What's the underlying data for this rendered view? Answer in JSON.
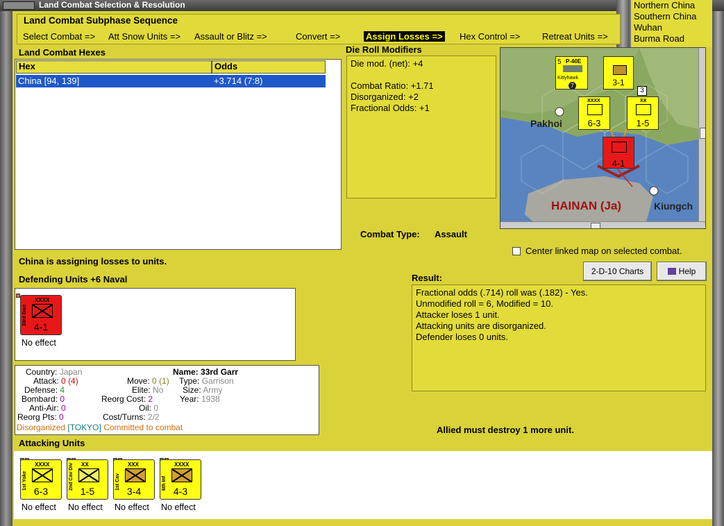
{
  "window": {
    "title": "Land Combat Selection & Resolution"
  },
  "subphase": {
    "heading": "Land Combat Subphase Sequence",
    "phases": [
      "Select Combat =>",
      "Att Snow Units =>",
      "Assault or Blitz =>",
      "Convert =>",
      "Assign Losses =>",
      "Hex Control =>",
      "Retreat Units =>"
    ],
    "active_index": 4
  },
  "hexes": {
    "heading": "Land Combat Hexes",
    "columns": [
      "Hex",
      "Odds"
    ],
    "rows": [
      {
        "hex": "China [94, 139]",
        "odds": "+3.714 (7:8)"
      }
    ]
  },
  "modifiers": {
    "heading": "Die Roll Modifiers",
    "lines": [
      "Die mod. (net): +4",
      "",
      "Combat Ratio: +1.71",
      "Disorganized: +2",
      "Fractional Odds: +1"
    ]
  },
  "map": {
    "labels": [
      "Pakhoi",
      "HAINAN (Ja)",
      "Kiungch"
    ],
    "units": [
      {
        "name": "P-40E",
        "value": "Kittyhawk",
        "num": "5",
        "circle": "7"
      },
      {
        "name": "Yoke",
        "value": "3-1"
      },
      {
        "name": "1st Yoke",
        "size": "XXXX",
        "value": "6-3"
      },
      {
        "name": "2nd Cav Div",
        "size": "XX",
        "value": "1-5"
      },
      {
        "name": "33rd Garr",
        "size": "XXXX",
        "value": "4-1"
      }
    ],
    "stack_count": "3"
  },
  "combat_type": {
    "label": "Combat Type:",
    "value": "Assault"
  },
  "center_map": {
    "label": "Center linked map on selected combat.",
    "checked": false
  },
  "buttons": {
    "charts": "2-D-10 Charts",
    "help": "Help"
  },
  "status_line": "China is assigning losses to units.",
  "defending": {
    "heading": "Defending Units +6 Naval",
    "units": [
      {
        "name": "33rd Garr",
        "size": "XXXX",
        "value": "4-1",
        "effect": "No effect",
        "color": "#e81818"
      }
    ]
  },
  "result": {
    "heading": "Result:",
    "lines": [
      "Fractional odds (.714) roll was (.182)  - Yes.",
      "Unmodified roll = 6, Modified = 10.",
      "Attacker loses 1 unit.",
      "Attacking units are disorganized.",
      "Defender loses 0 units."
    ]
  },
  "unit_info": {
    "country_label": "Country:",
    "country": "Japan",
    "attack_label": "Attack:",
    "attack": "0",
    "attack_paren": "(4)",
    "defense_label": "Defense:",
    "defense": "4",
    "bombard_label": "Bombard:",
    "bombard": "0",
    "antiair_label": "Anti-Air:",
    "antiair": "0",
    "reorgpts_label": "Reorg Pts:",
    "reorgpts": "0",
    "name_label": "Name:",
    "name": "33rd Garr",
    "move_label": "Move:",
    "move": "0",
    "move_paren": "(1)",
    "elite_label": "Elite:",
    "elite": "No",
    "reorgcost_label": "Reorg Cost:",
    "reorgcost": "2",
    "oil_label": "Oil:",
    "oil": "0",
    "costturns_label": "Cost/Turns:",
    "costturns": "2/2",
    "type_label": "Type:",
    "type": "Garrison",
    "size_label": "Size:",
    "size": "Army",
    "year_label": "Year:",
    "year": "1938",
    "status_disorg": "Disorganized",
    "status_hq": "[TOKYO]",
    "status_committed": "Committed to combat"
  },
  "allied_msg": "Allied must destroy 1 more unit.",
  "attacking": {
    "heading": "Attacking Units",
    "units": [
      {
        "name": "1st Yoke",
        "size": "XXXX",
        "value": "6-3",
        "effect": "No effect"
      },
      {
        "name": "2nd Cav Div",
        "size": "XX",
        "value": "1-5",
        "effect": "No effect"
      },
      {
        "name": "1st Cav",
        "size": "XXX",
        "value": "3-4",
        "effect": "No effect"
      },
      {
        "name": "6th Inf",
        "size": "XXXX",
        "value": "4-3",
        "effect": "No effect"
      }
    ]
  },
  "region_list": [
    "Northern China",
    "Southern China",
    "Wuhan",
    "Burma Road"
  ],
  "colors": {
    "panel": "#d9d238",
    "unit_yellow": "#ffff14",
    "unit_red": "#e81818",
    "selection": "#1e58c8"
  }
}
